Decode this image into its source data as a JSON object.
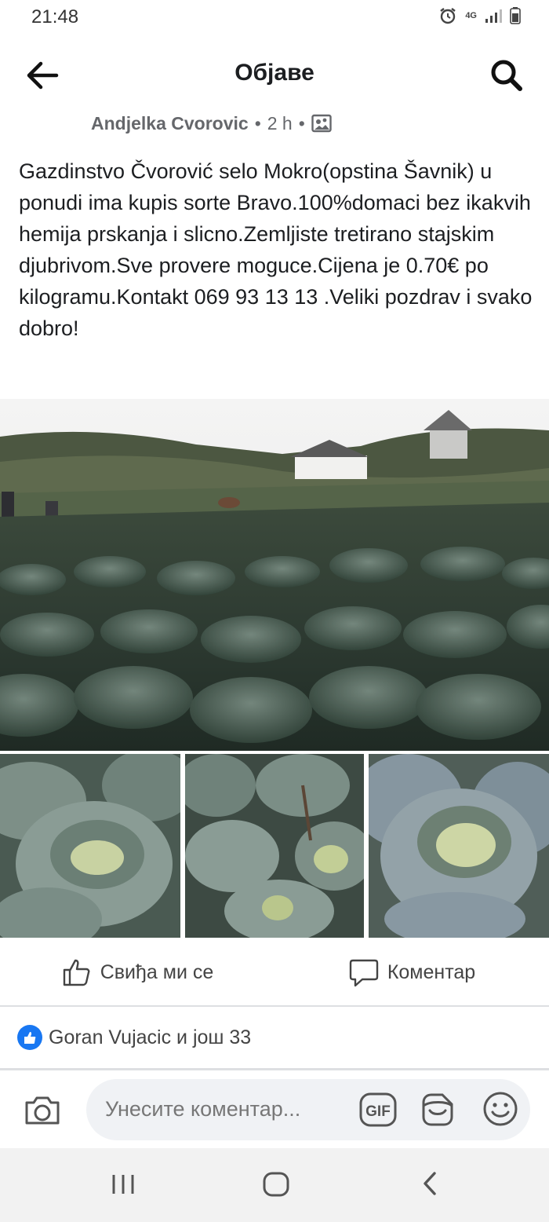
{
  "status_bar": {
    "time": "21:48",
    "network": "4G"
  },
  "header": {
    "title": "Објаве",
    "back_icon": "arrow-left-icon",
    "search_icon": "search-icon"
  },
  "post": {
    "author": "Andjelka Cvorovic",
    "separator": "•",
    "time": "2 h",
    "privacy_icon": "photo-album-icon",
    "text": "Gazdinstvo Čvorović selo Mokro(opstina Šavnik) u ponudi ima kupis sorte Bravo.100%domaci bez ikakvih hemija prskanja i slicno.Zemljiste tretirano stajskim djubrivom.Sve provere moguce.Cijena je 0.70€ po kilogramu.Kontakt 069 93 13 13 .Veliki pozdrav i svako dobro!",
    "photos": {
      "main": "cabbage-field-photo",
      "thumbnails": [
        "cabbage-head-photo",
        "cabbage-rows-photo",
        "cabbage-closeup-photo"
      ]
    }
  },
  "actions": {
    "like_label": "Свиђа ми се",
    "comment_label": "Коментар"
  },
  "reactions": {
    "summary": "Goran Vujacic и још 33"
  },
  "composer": {
    "placeholder": "Унесите коментар...",
    "gif_label": "GIF"
  },
  "colors": {
    "like_blue": "#1877f2",
    "text": "#1c1e21",
    "secondary": "#65676b"
  }
}
